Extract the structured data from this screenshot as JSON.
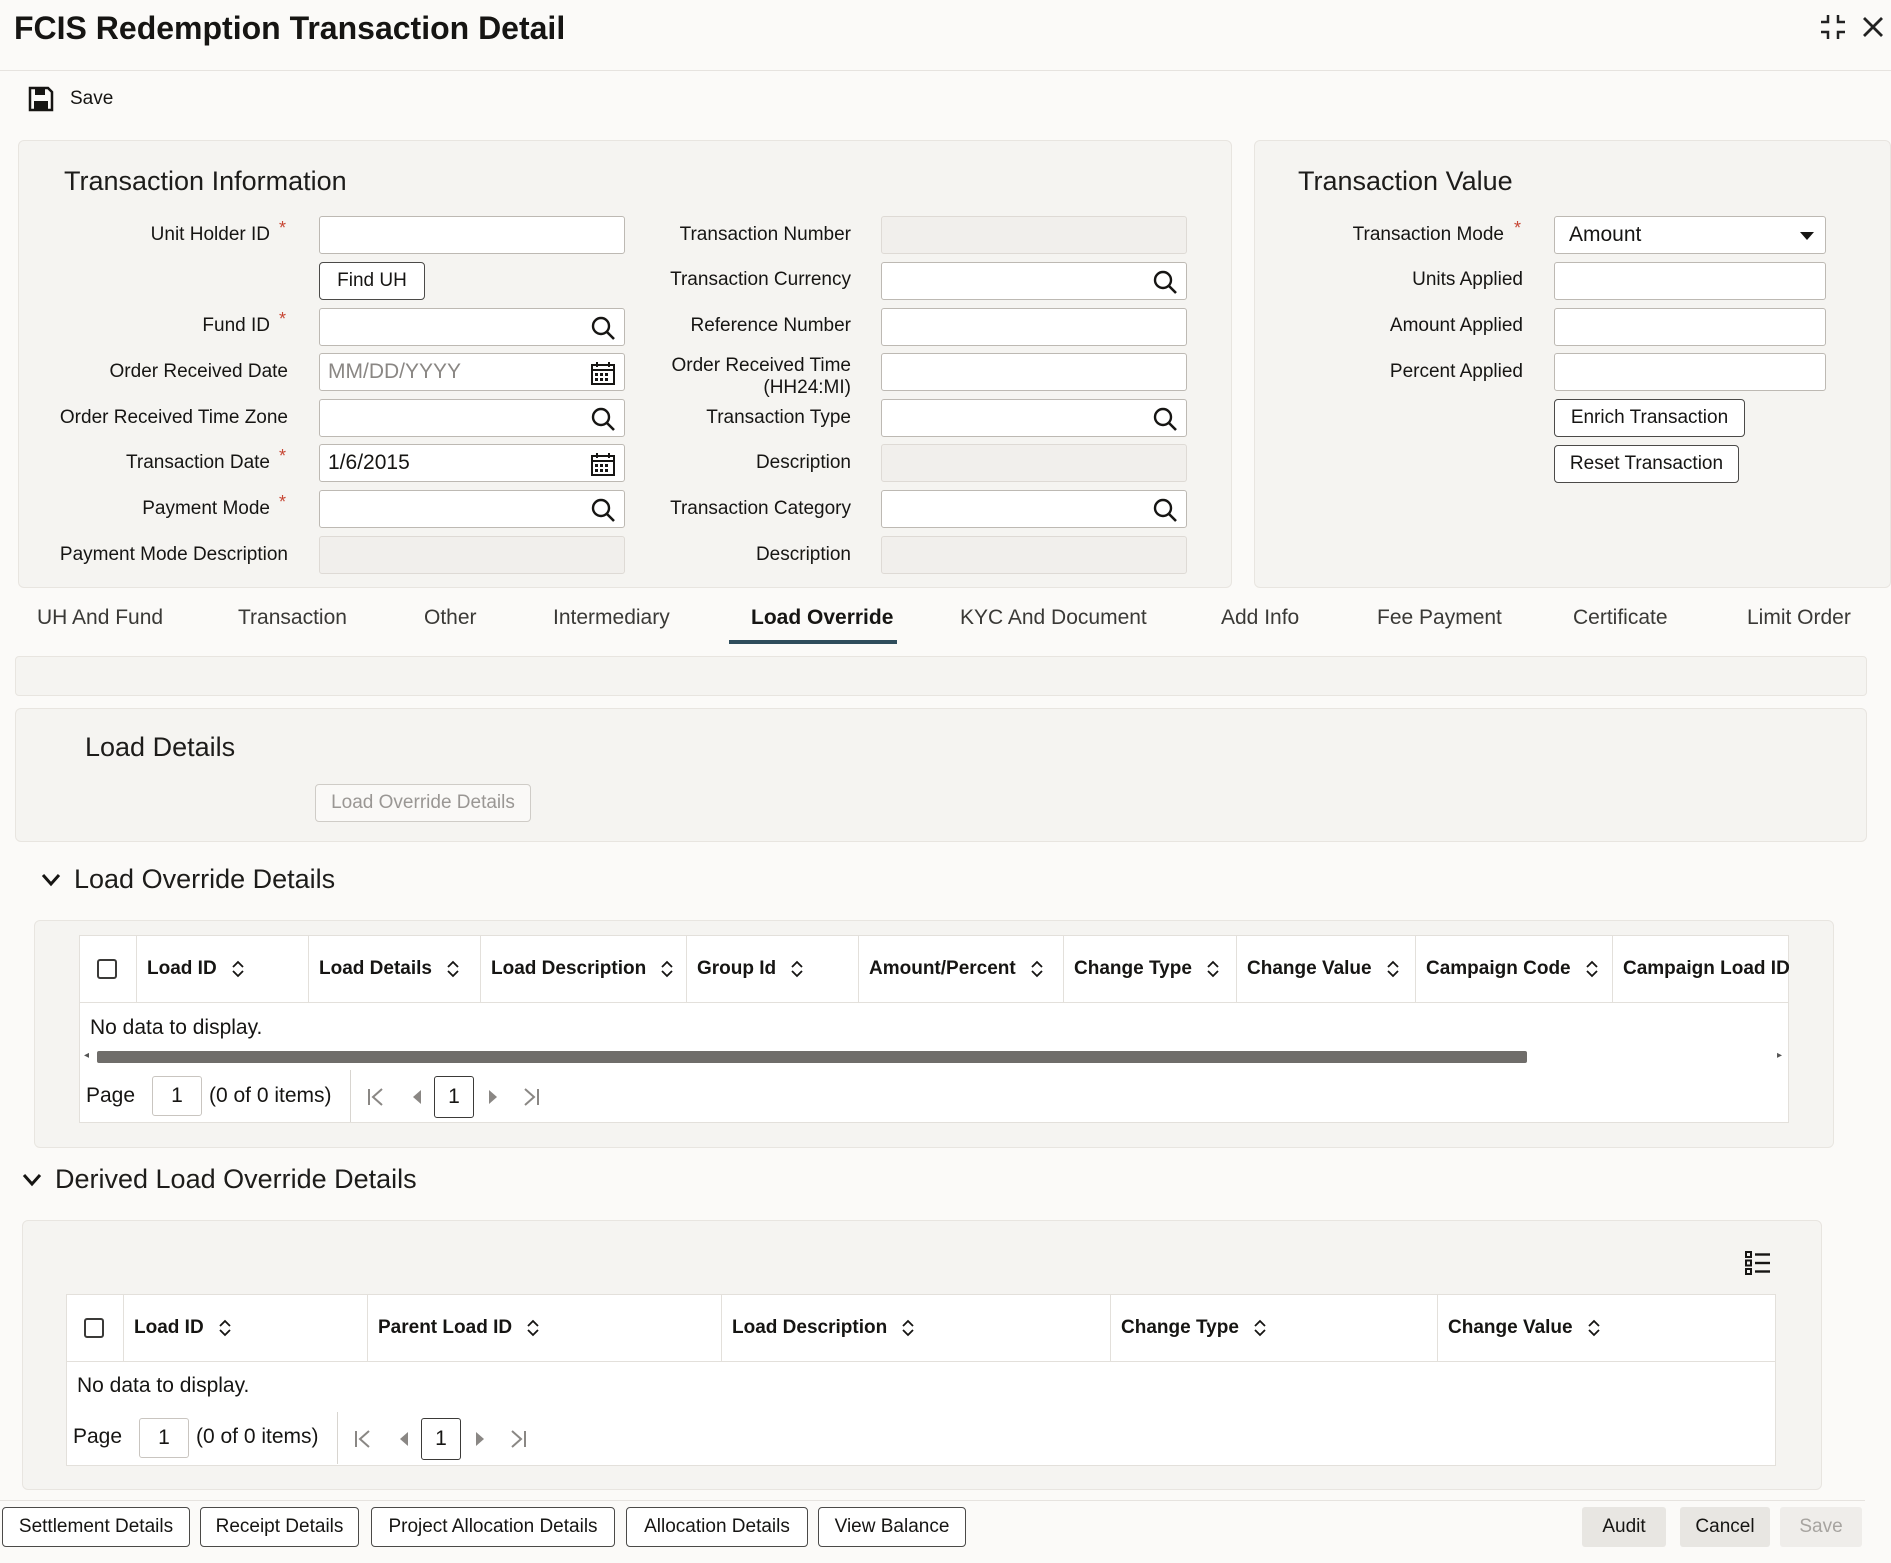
{
  "window": {
    "title": "FCIS Redemption Transaction Detail"
  },
  "toolbar": {
    "save_label": "Save"
  },
  "transaction_information": {
    "title": "Transaction Information",
    "unit_holder_id": {
      "label": "Unit Holder ID",
      "value": ""
    },
    "find_uh_label": "Find UH",
    "fund_id": {
      "label": "Fund ID",
      "value": ""
    },
    "order_received_date": {
      "label": "Order Received Date",
      "placeholder": "MM/DD/YYYY"
    },
    "order_received_time_zone": {
      "label": "Order Received Time Zone",
      "value": ""
    },
    "transaction_date": {
      "label": "Transaction Date",
      "value": "1/6/2015"
    },
    "payment_mode": {
      "label": "Payment Mode",
      "value": ""
    },
    "payment_mode_description": {
      "label": "Payment Mode Description",
      "value": ""
    },
    "transaction_number": {
      "label": "Transaction Number",
      "value": ""
    },
    "transaction_currency": {
      "label": "Transaction Currency",
      "value": ""
    },
    "reference_number": {
      "label": "Reference Number",
      "value": ""
    },
    "order_received_time": {
      "label_line1": "Order Received Time",
      "label_line2": "(HH24:MI)",
      "value": ""
    },
    "transaction_type": {
      "label": "Transaction Type",
      "value": ""
    },
    "description_1": {
      "label": "Description",
      "value": ""
    },
    "transaction_category": {
      "label": "Transaction Category",
      "value": ""
    },
    "description_2": {
      "label": "Description",
      "value": ""
    }
  },
  "transaction_value": {
    "title": "Transaction Value",
    "transaction_mode": {
      "label": "Transaction Mode",
      "value": "Amount"
    },
    "units_applied": {
      "label": "Units Applied",
      "value": ""
    },
    "amount_applied": {
      "label": "Amount Applied",
      "value": ""
    },
    "percent_applied": {
      "label": "Percent Applied",
      "value": ""
    },
    "enrich_label": "Enrich Transaction",
    "reset_label": "Reset Transaction"
  },
  "tabs": [
    {
      "label": "UH And Fund"
    },
    {
      "label": "Transaction"
    },
    {
      "label": "Other"
    },
    {
      "label": "Intermediary"
    },
    {
      "label": "Load Override"
    },
    {
      "label": "KYC And Document"
    },
    {
      "label": "Add Info"
    },
    {
      "label": "Fee Payment"
    },
    {
      "label": "Certificate"
    },
    {
      "label": "Limit Order"
    }
  ],
  "active_tab": "Load Override",
  "load_details": {
    "title": "Load Details",
    "button_label": "Load Override Details"
  },
  "load_override_details": {
    "title": "Load Override Details",
    "columns": [
      "Load ID",
      "Load Details",
      "Load Description",
      "Group Id",
      "Amount/Percent",
      "Change Type",
      "Change Value",
      "Campaign Code",
      "Campaign Load ID"
    ],
    "no_data": "No data to display.",
    "page_label": "Page",
    "page_value": "1",
    "items_text": "(0 of 0 items)",
    "current_page": "1"
  },
  "derived_load_override_details": {
    "title": "Derived Load Override Details",
    "columns": [
      "Load ID",
      "Parent Load ID",
      "Load Description",
      "Change Type",
      "Change Value"
    ],
    "no_data": "No data to display.",
    "page_label": "Page",
    "page_value": "1",
    "items_text": "(0 of 0 items)",
    "current_page": "1"
  },
  "footer": {
    "settlement": "Settlement Details",
    "receipt": "Receipt Details",
    "project_allocation": "Project Allocation Details",
    "allocation": "Allocation Details",
    "view_balance": "View Balance",
    "audit": "Audit",
    "cancel": "Cancel",
    "save": "Save"
  },
  "colors": {
    "accent": "#2f4d5c",
    "required": "#c74634"
  }
}
